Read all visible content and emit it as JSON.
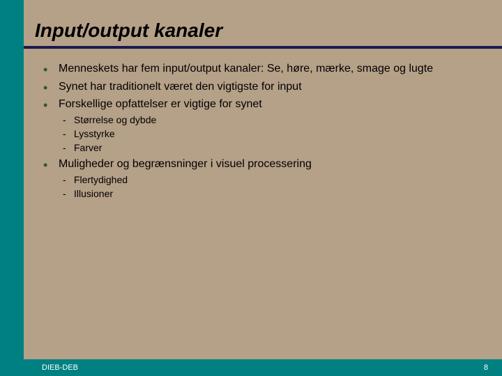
{
  "slide": {
    "title": "Input/output kanaler",
    "bullets": [
      {
        "text": "Menneskets har fem input/output kanaler: Se, høre, mærke, smage og lugte"
      },
      {
        "text": "Synet har traditionelt været den vigtigste for input"
      },
      {
        "text": "Forskellige opfattelser er vigtige for synet",
        "sub": [
          "Størrelse og dybde",
          "Lysstyrke",
          "Farver"
        ]
      },
      {
        "text": "Muligheder og begrænsninger i visuel processering",
        "sub": [
          "Flertydighed",
          "Illusioner"
        ]
      }
    ]
  },
  "footer": {
    "left": "DIEB-DEB",
    "page": "8"
  },
  "colors": {
    "background": "#b5a088",
    "accent": "#008080",
    "rule": "#1a1a4d",
    "bullet": "#2d5a2d"
  }
}
